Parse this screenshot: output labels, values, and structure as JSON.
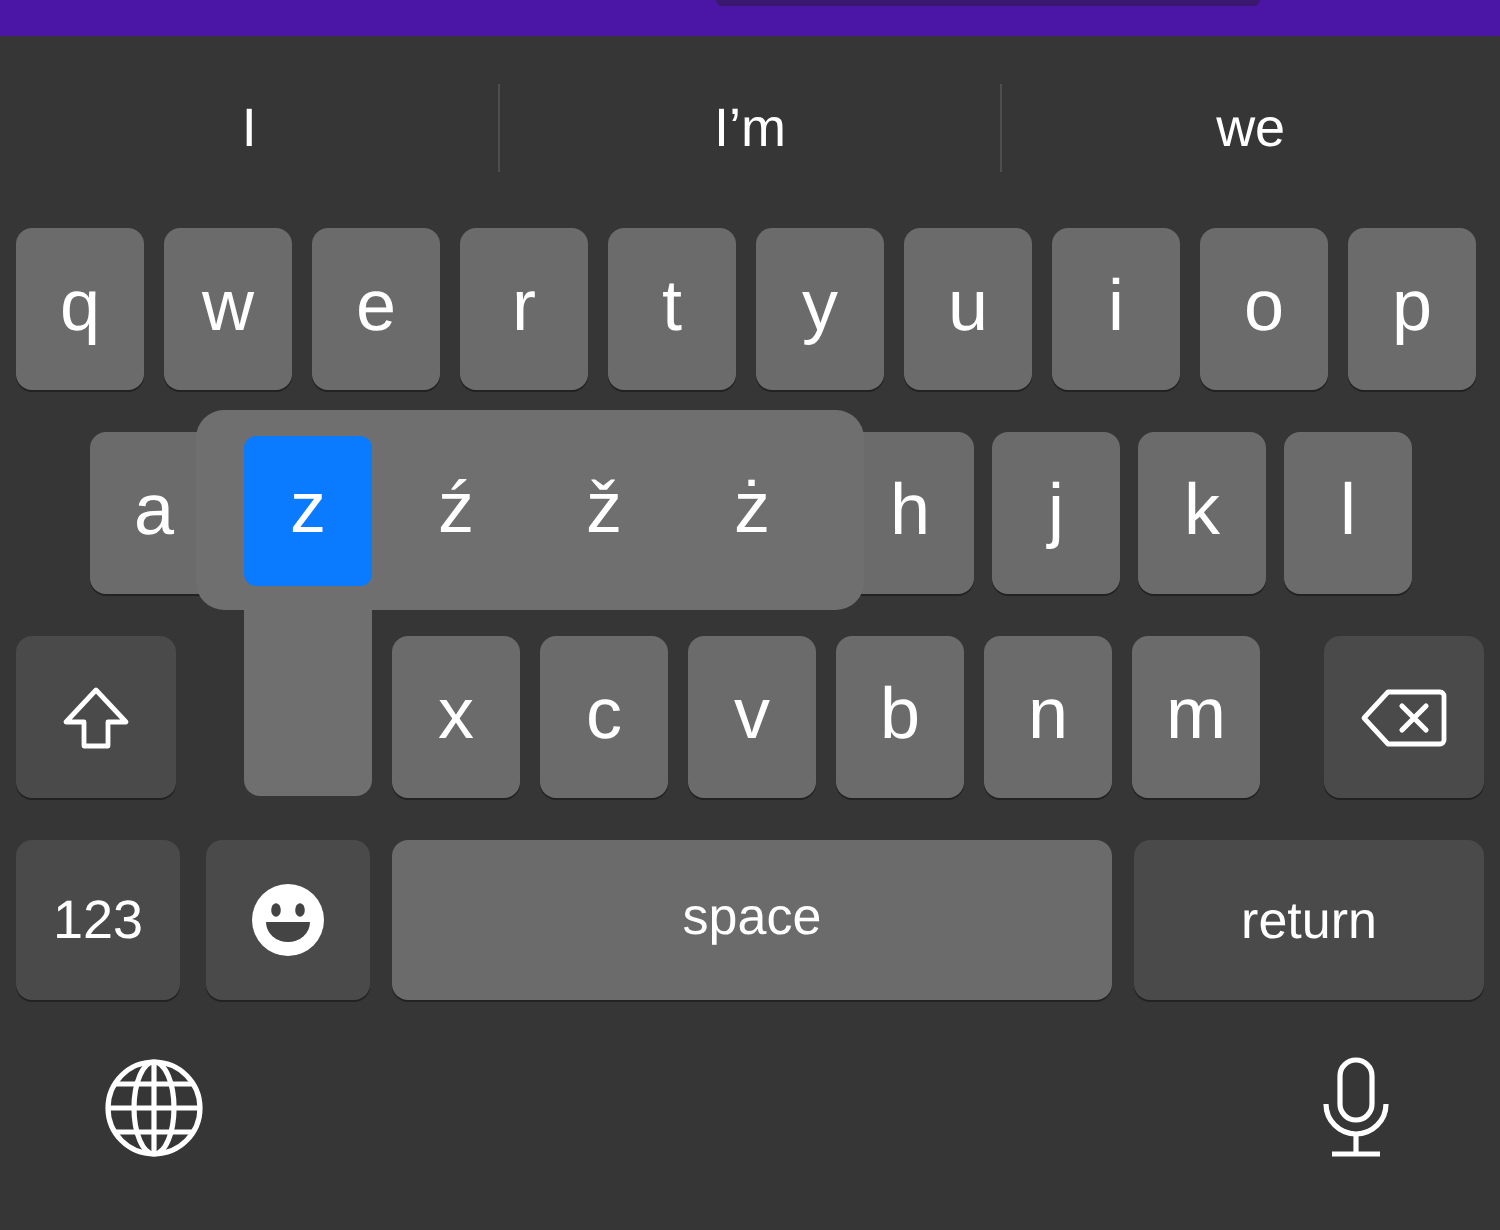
{
  "suggestions": [
    {
      "text": "I"
    },
    {
      "text": "I’m"
    },
    {
      "text": "we"
    }
  ],
  "rows": [
    {
      "keys": [
        {
          "kind": "letter",
          "label": "q"
        },
        {
          "kind": "letter",
          "label": "w"
        },
        {
          "kind": "letter",
          "label": "e"
        },
        {
          "kind": "letter",
          "label": "r"
        },
        {
          "kind": "letter",
          "label": "t"
        },
        {
          "kind": "letter",
          "label": "y"
        },
        {
          "kind": "letter",
          "label": "u"
        },
        {
          "kind": "letter",
          "label": "i"
        },
        {
          "kind": "letter",
          "label": "o"
        },
        {
          "kind": "letter",
          "label": "p"
        }
      ]
    },
    {
      "keys": [
        {
          "kind": "letter",
          "label": "a"
        },
        {
          "kind": "letter",
          "label": "h"
        },
        {
          "kind": "letter",
          "label": "j"
        },
        {
          "kind": "letter",
          "label": "k"
        },
        {
          "kind": "letter",
          "label": "l"
        }
      ]
    },
    {
      "keys": [
        {
          "kind": "shift"
        },
        {
          "kind": "letter",
          "label": "x"
        },
        {
          "kind": "letter",
          "label": "c"
        },
        {
          "kind": "letter",
          "label": "v"
        },
        {
          "kind": "letter",
          "label": "b"
        },
        {
          "kind": "letter",
          "label": "n"
        },
        {
          "kind": "letter",
          "label": "m"
        },
        {
          "kind": "delete"
        }
      ]
    },
    {
      "keys": [
        {
          "kind": "mode",
          "label": "123"
        },
        {
          "kind": "emoji"
        },
        {
          "kind": "space",
          "label": "space"
        },
        {
          "kind": "return",
          "label": "return"
        }
      ]
    }
  ],
  "accent_popup": {
    "options": [
      {
        "label": "z",
        "selected": true
      },
      {
        "label": "ź",
        "selected": false
      },
      {
        "label": "ž",
        "selected": false
      },
      {
        "label": "ż",
        "selected": false
      }
    ]
  }
}
